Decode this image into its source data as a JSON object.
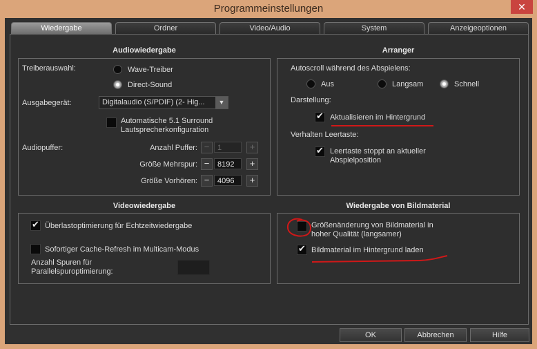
{
  "window": {
    "title": "Programmeinstellungen",
    "close_glyph": "✕"
  },
  "tabs": [
    "Wiedergabe",
    "Ordner",
    "Video/Audio",
    "System",
    "Anzeigeoptionen"
  ],
  "audio": {
    "title": "Audiowiedergabe",
    "driver_label": "Treiberauswahl:",
    "driver_options": [
      {
        "label": "Wave-Treiber",
        "selected": false
      },
      {
        "label": "Direct-Sound",
        "selected": true
      }
    ],
    "device_label": "Ausgabegerät:",
    "device_value": "Digitalaudio (S/PDIF) (2- Hig...",
    "surround_label": "Automatische 5.1 Surround Lautsprecherkonfiguration",
    "surround_checked": false,
    "buffer_label": "Audiopuffer:",
    "buffers": [
      {
        "label": "Anzahl Puffer:",
        "value": "1",
        "disabled": true
      },
      {
        "label": "Größe Mehrspur:",
        "value": "8192",
        "disabled": false
      },
      {
        "label": "Größe Vorhören:",
        "value": "4096",
        "disabled": false
      }
    ]
  },
  "arranger": {
    "title": "Arranger",
    "autoscroll_label": "Autoscroll während des Abspielens:",
    "autoscroll_options": [
      {
        "label": "Aus",
        "selected": false
      },
      {
        "label": "Langsam",
        "selected": false
      },
      {
        "label": "Schnell",
        "selected": true
      }
    ],
    "display_label": "Darstellung:",
    "background_update_label": "Aktualisieren im Hintergrund",
    "background_update_checked": true,
    "space_label": "Verhalten Leertaste:",
    "space_stop_label": "Leertaste stoppt an aktueller Abspielposition",
    "space_stop_checked": true
  },
  "video": {
    "title": "Videowiedergabe",
    "overload_label": "Überlastoptimierung für Echtzeitwiedergabe",
    "overload_checked": true,
    "cache_label": "Sofortiger Cache-Refresh im Multicam-Modus",
    "cache_checked": false,
    "tracks_label": "Anzahl Spuren für Parallelspuroptimierung:"
  },
  "images": {
    "title": "Wiedergabe von Bildmaterial",
    "resize_label": "Größenänderung von Bildmaterial in hoher Qualität (langsamer)",
    "resize_checked": false,
    "bg_load_label": "Bildmaterial im Hintergrund laden",
    "bg_load_checked": true
  },
  "buttons": {
    "ok": "OK",
    "cancel": "Abbrechen",
    "help": "Hilfe"
  },
  "colors": {
    "title_bar": "#dba57a",
    "annotation_red": "#d01818"
  }
}
